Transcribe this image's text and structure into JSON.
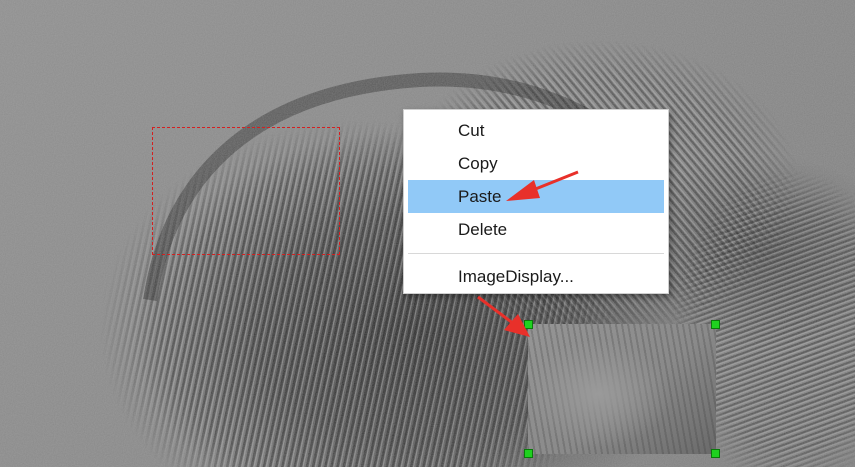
{
  "context_menu": {
    "items": [
      {
        "label": "Cut",
        "highlighted": false
      },
      {
        "label": "Copy",
        "highlighted": false
      },
      {
        "label": "Paste",
        "highlighted": true
      },
      {
        "label": "Delete",
        "highlighted": false
      },
      {
        "label": "ImageDisplay...",
        "highlighted": false
      }
    ],
    "highlight_color": "#91c9f7"
  },
  "colors": {
    "selection_border": "#d42020",
    "handle": "#1fd11f",
    "annotation_arrow": "#e8302a"
  }
}
